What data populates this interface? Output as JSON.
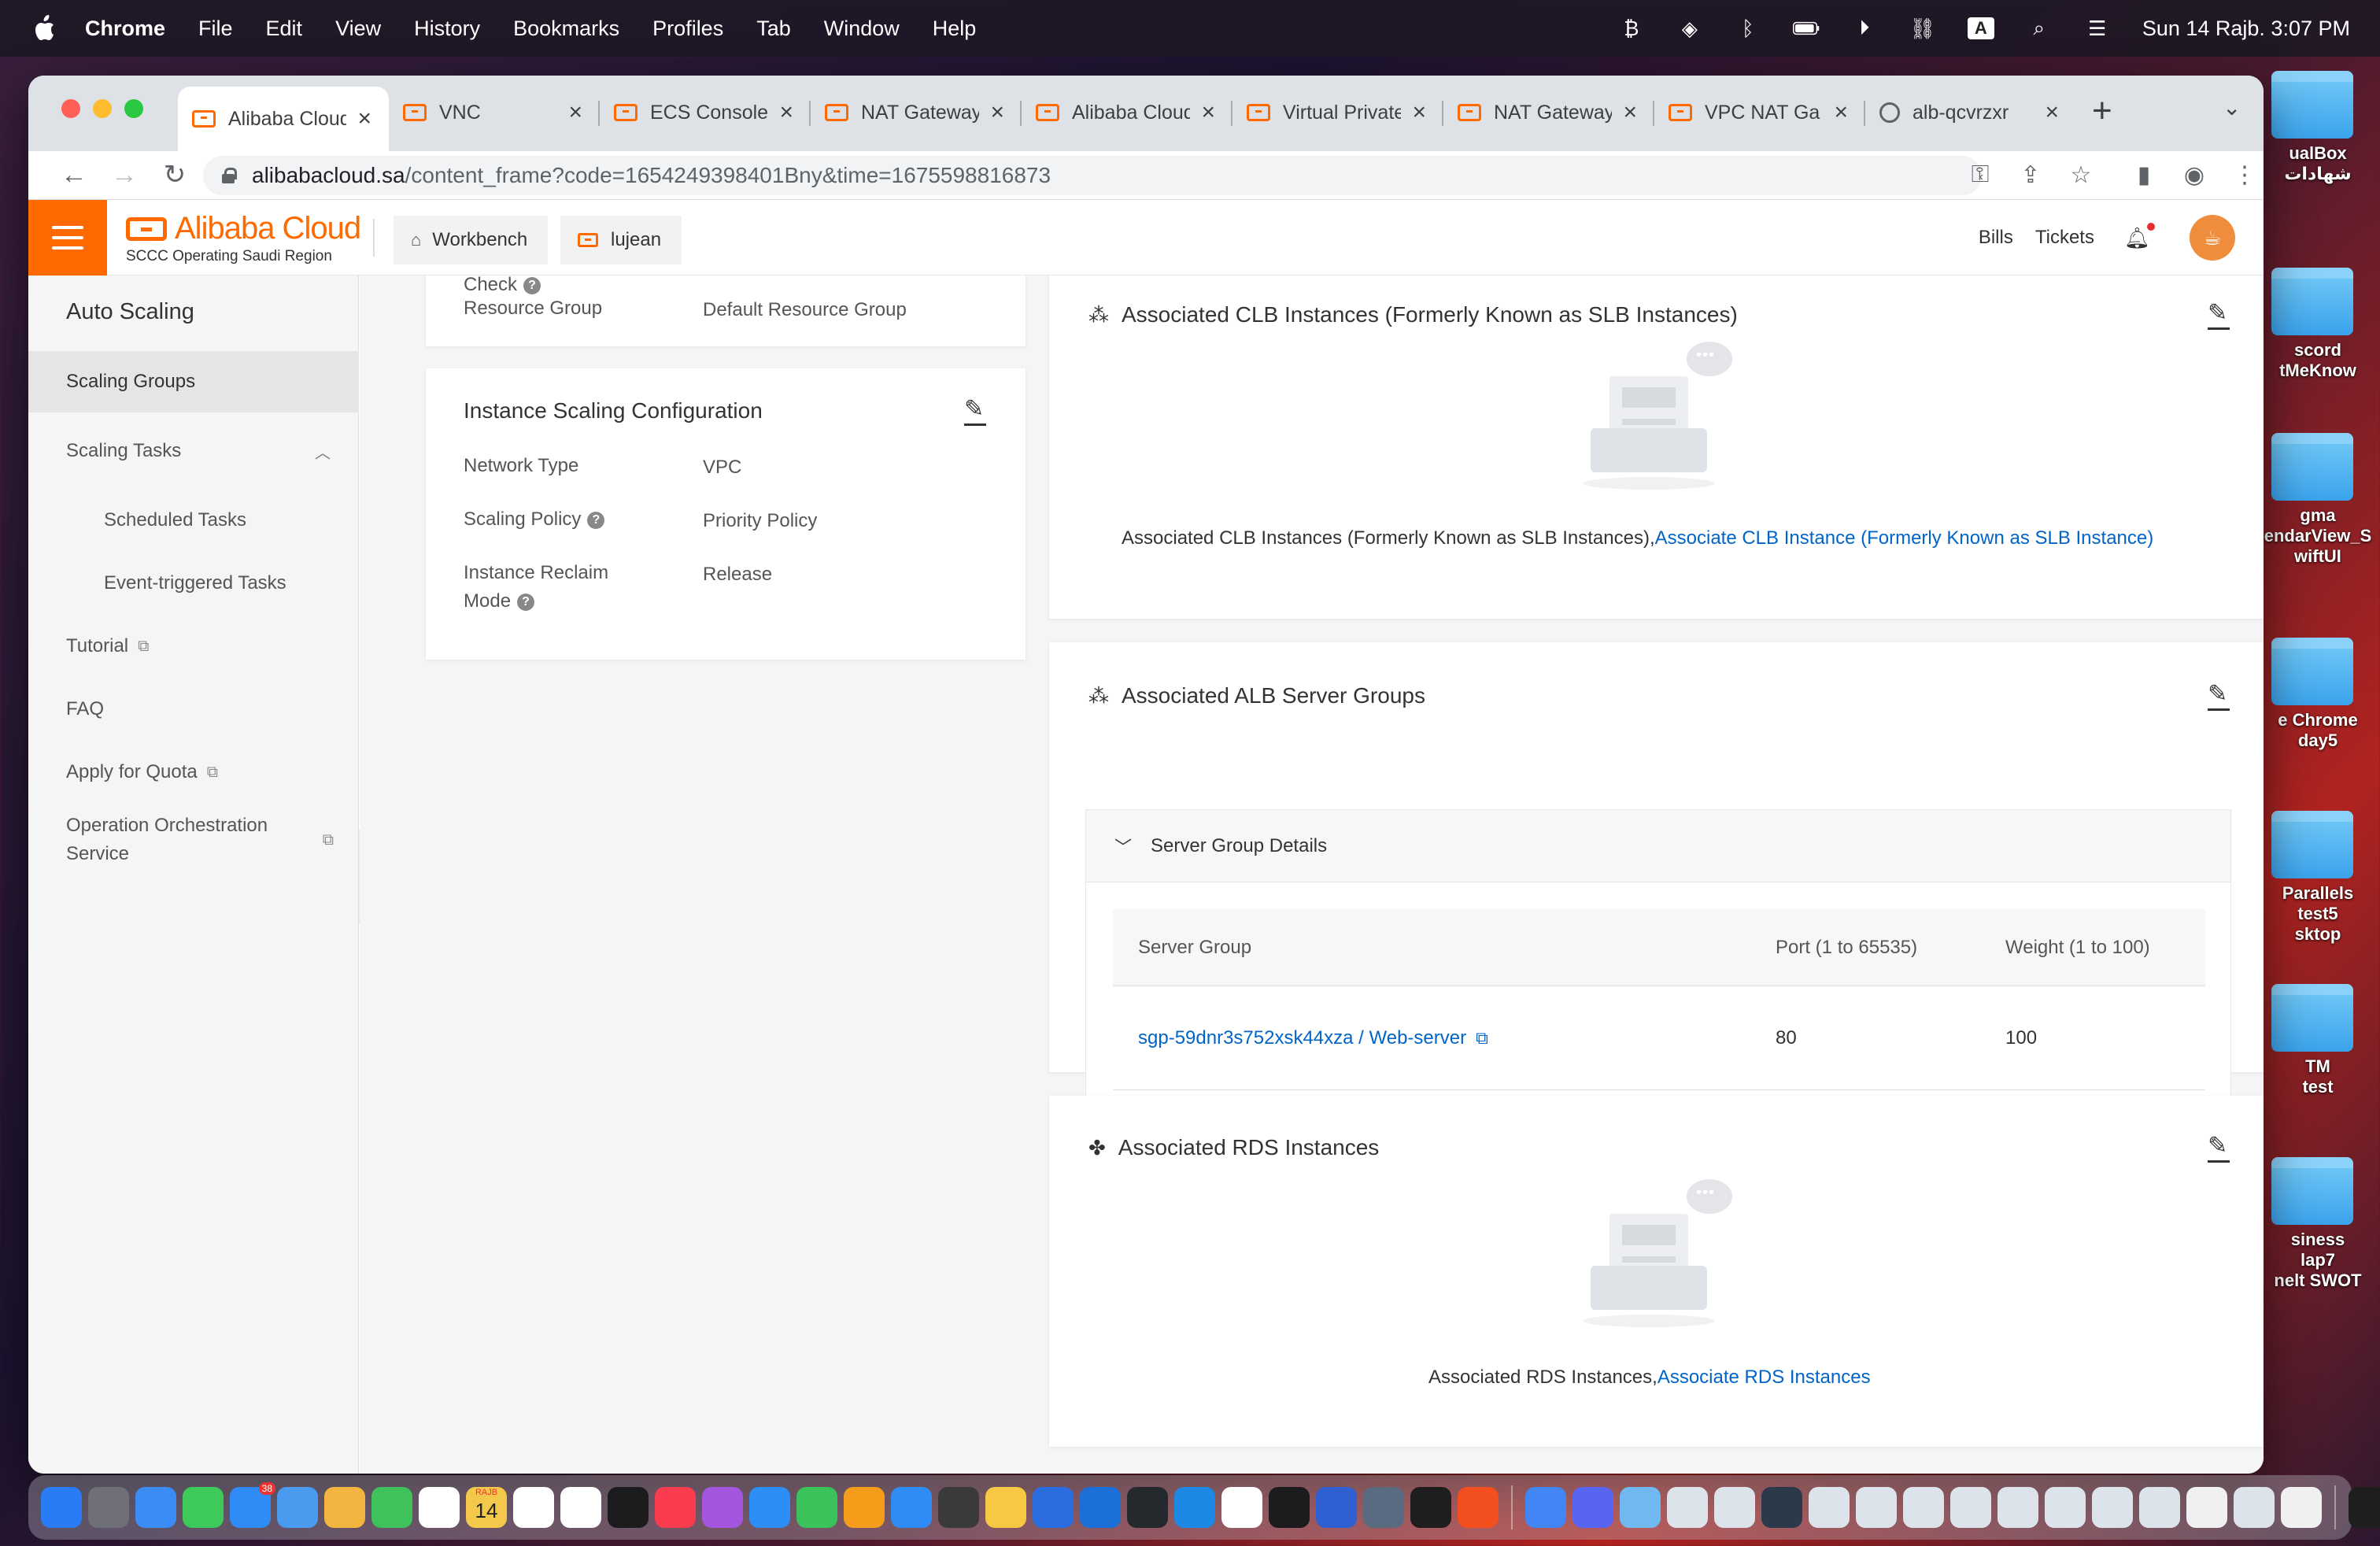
{
  "menubar": {
    "app": "Chrome",
    "items": [
      "File",
      "Edit",
      "View",
      "History",
      "Bookmarks",
      "Profiles",
      "Tab",
      "Window",
      "Help"
    ],
    "datetime": "Sun 14 Rajb.  3:07 PM",
    "input_source": "A"
  },
  "desktop": {
    "labels": [
      "ualBox",
      "شهادات",
      "scord",
      "tMeKnow",
      "gma",
      "endarView_S",
      "wiftUI",
      "e Chrome",
      "day5",
      "Parallels",
      "test5",
      "sktop",
      "TM",
      "test",
      "siness",
      "lap7",
      "nelt SWOT"
    ]
  },
  "tabs": [
    {
      "title": "Alibaba Cloud",
      "icon": "alibaba-icon",
      "active": true
    },
    {
      "title": "VNC",
      "icon": "alibaba-icon",
      "active": false
    },
    {
      "title": "ECS Console",
      "icon": "alibaba-icon",
      "active": false
    },
    {
      "title": "NAT Gateway",
      "icon": "alibaba-icon",
      "active": false
    },
    {
      "title": "Alibaba Cloud",
      "icon": "alibaba-icon",
      "active": false
    },
    {
      "title": "Virtual Private",
      "icon": "alibaba-icon",
      "active": false
    },
    {
      "title": "NAT Gateway",
      "icon": "alibaba-icon",
      "active": false
    },
    {
      "title": "VPC NAT Ga",
      "icon": "alibaba-icon",
      "active": false
    },
    {
      "title": "alb-qcvrzxr",
      "icon": "globe-icon",
      "active": false
    }
  ],
  "address": {
    "host": "alibabacloud.sa",
    "path": "/content_frame?code=1654249398401Bny&time=1675598816873"
  },
  "header": {
    "brand": "Alibaba Cloud",
    "region": "SCCC Operating Saudi Region",
    "workbench": "Workbench",
    "account": "lujean",
    "bills": "Bills",
    "tickets": "Tickets"
  },
  "sidebar": {
    "title": "Auto Scaling",
    "items": [
      {
        "label": "Scaling Groups"
      },
      {
        "label": "Scaling Tasks"
      },
      {
        "label": "Scheduled Tasks"
      },
      {
        "label": "Event-triggered Tasks"
      },
      {
        "label": "Tutorial"
      },
      {
        "label": "FAQ"
      },
      {
        "label": "Apply for Quota"
      },
      {
        "label": "Operation Orchestration Service"
      }
    ]
  },
  "basic": {
    "partial_label": "Check",
    "resource_group_label": "Resource Group",
    "resource_group_value": "Default Resource Group"
  },
  "scaling_config": {
    "title": "Instance Scaling Configuration",
    "network_type_label": "Network Type",
    "network_type_value": "VPC",
    "scaling_policy_label": "Scaling Policy",
    "scaling_policy_value": "Priority Policy",
    "reclaim_label_1": "Instance Reclaim",
    "reclaim_label_2": "Mode",
    "reclaim_value": "Release"
  },
  "clb": {
    "title": "Associated CLB Instances (Formerly Known as SLB Instances)",
    "empty_text": "Associated CLB Instances (Formerly Known as SLB Instances),",
    "empty_link": "Associate CLB Instance (Formerly Known as SLB Instance)"
  },
  "alb": {
    "title": "Associated ALB Server Groups",
    "panel_title": "Server Group Details",
    "columns": [
      "Server Group",
      "Port (1 to 65535)",
      "Weight (1 to 100)"
    ],
    "rows": [
      {
        "server_group": "sgp-59dnr3s752xsk44xza / Web-server",
        "port": "80",
        "weight": "100"
      }
    ]
  },
  "rds": {
    "title": "Associated RDS Instances",
    "empty_text": "Associated RDS Instances,",
    "empty_link": "Associate RDS Instances"
  },
  "dock": {
    "calendar_month": "RAJB",
    "calendar_day": "14",
    "mail_badge": "38",
    "colors": [
      "#2a7bf6",
      "#6f6f78",
      "#3b8cf5",
      "#3ec95b",
      "#2f8bf5",
      "#4a9af0",
      "#f3b53f",
      "#3fc25c",
      "#ffffff",
      "#f4c84a",
      "#ffffff",
      "#ffffff",
      "#1c1c1e",
      "#fb3c4e",
      "#a456e0",
      "#2c8ef6",
      "#3bc25b",
      "#f59c1a",
      "#2f8cf6",
      "#3a3a3c",
      "#f6c843",
      "#2a6de0",
      "#1d6fd8",
      "#24292e",
      "#1e88e5",
      "#ffffff",
      "#1c1c1e",
      "#2f5fd0",
      "#5a6a80",
      "#1e1e1e",
      "#f24e1e",
      "#4285f4",
      "#5865f2",
      "#6fb8f0",
      "#dde3ea",
      "#dde3ea",
      "#2a3a4a",
      "#dde3ea",
      "#dde3ea",
      "#dde3ea",
      "#dde3ea",
      "#dde3ea",
      "#dde3ea",
      "#dde3ea",
      "#dde3ea",
      "#f0f0f0",
      "#dde3ea",
      "#f0f0f0",
      "#1e1e1e",
      "#cccccc"
    ]
  }
}
